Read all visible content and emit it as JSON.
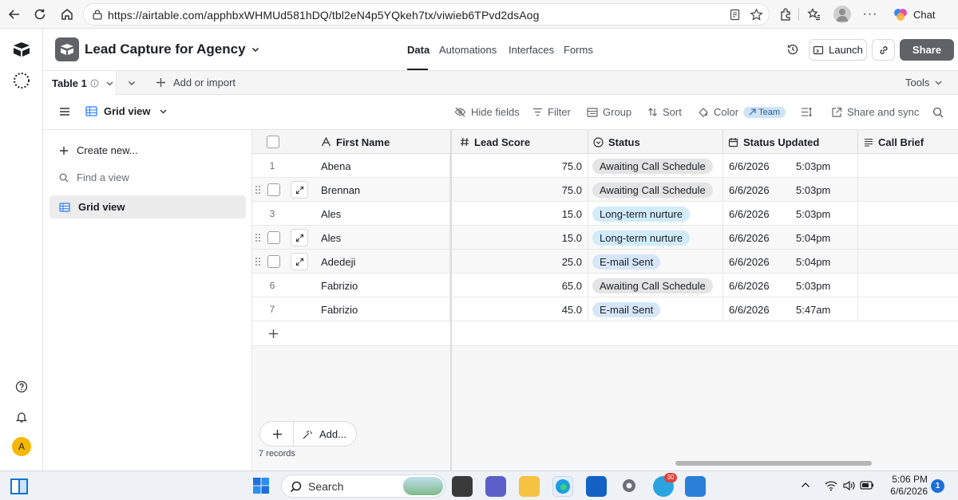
{
  "browser": {
    "url": "https://airtable.com/apphbxWHMUd581hDQ/tbl2eN4p5YQkeh7tx/viwieb6TPvd2dsAog",
    "chat_label": "Chat"
  },
  "header": {
    "base_title": "Lead Capture for Agency",
    "tabs": [
      {
        "label": "Data",
        "active": true
      },
      {
        "label": "Automations",
        "active": false
      },
      {
        "label": "Interfaces",
        "active": false
      },
      {
        "label": "Forms",
        "active": false
      }
    ],
    "launch_label": "Launch",
    "share_label": "Share"
  },
  "tabbar": {
    "table_name": "Table 1",
    "add_import_label": "Add or import",
    "tools_label": "Tools"
  },
  "toolbar": {
    "view_name": "Grid view",
    "hide_fields": "Hide fields",
    "filter": "Filter",
    "group": "Group",
    "sort": "Sort",
    "color": "Color",
    "team_pill": "Team",
    "share_sync": "Share and sync"
  },
  "sidebar": {
    "create_new": "Create new...",
    "find_view": "Find a view",
    "active_view": "Grid view"
  },
  "grid": {
    "columns": [
      "First Name",
      "Lead Score",
      "Status",
      "Status Updated",
      "Call Brief"
    ],
    "rows": [
      {
        "num": "1",
        "first_name": "Abena",
        "lead_score": "75.0",
        "status": "Awaiting Call Schedule",
        "date": "6/6/2026",
        "time": "5:03pm"
      },
      {
        "num": "",
        "first_name": "Brennan",
        "lead_score": "75.0",
        "status": "Awaiting Call Schedule",
        "date": "6/6/2026",
        "time": "5:03pm"
      },
      {
        "num": "3",
        "first_name": "Ales",
        "lead_score": "15.0",
        "status": "Long-term nurture",
        "date": "6/6/2026",
        "time": "5:03pm"
      },
      {
        "num": "",
        "first_name": "Ales",
        "lead_score": "15.0",
        "status": "Long-term nurture",
        "date": "6/6/2026",
        "time": "5:04pm"
      },
      {
        "num": "",
        "first_name": "Adedeji",
        "lead_score": "25.0",
        "status": "E-mail Sent",
        "date": "6/6/2026",
        "time": "5:04pm"
      },
      {
        "num": "6",
        "first_name": "Fabrizio",
        "lead_score": "65.0",
        "status": "Awaiting Call Schedule",
        "date": "6/6/2026",
        "time": "5:03pm"
      },
      {
        "num": "7",
        "first_name": "Fabrizio",
        "lead_score": "45.0",
        "status": "E-mail Sent",
        "date": "6/6/2026",
        "time": "5:47am"
      }
    ],
    "status_colors": {
      "Awaiting Call Schedule": "#e4e4e4",
      "Long-term nurture": "#d0ecfb",
      "E-mail Sent": "#d6e6f9"
    },
    "add_label": "Add...",
    "records_count": "7 records"
  },
  "rail": {
    "avatar_letter": "A"
  },
  "taskbar": {
    "search_label": "Search",
    "time": "5:06 PM",
    "date": "6/6/2026",
    "notification_count": "1",
    "telegram_badge": "30"
  }
}
